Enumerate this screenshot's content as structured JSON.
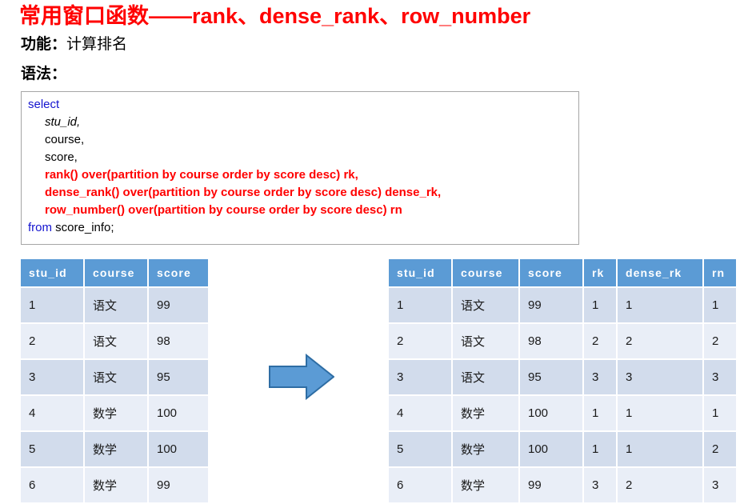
{
  "slide": {
    "title": "常用窗口函数——rank、dense_rank、row_number",
    "function_label": "功能：",
    "function_value": "计算排名",
    "syntax_label": "语法："
  },
  "colors": {
    "title_red": "#ff0000",
    "keyword_blue": "#1414cf",
    "code_red": "#ff0000",
    "header_blue": "#5b9bd5",
    "row_odd": "#d2dcec",
    "row_even": "#e9eef7",
    "arrow_fill": "#5b9bd5",
    "arrow_stroke": "#2e6da4",
    "code_border": "#a6a6a6"
  },
  "code": {
    "lines": [
      {
        "text": "select",
        "style": "keyword"
      },
      {
        "text": "stu_id,",
        "style": "italic-indent"
      },
      {
        "text": "course,",
        "style": "plain-indent"
      },
      {
        "text": "score,",
        "style": "plain-indent"
      },
      {
        "text": "rank() over(partition by course order by score desc) rk,",
        "style": "red-indent"
      },
      {
        "text": "dense_rank() over(partition by course order by score desc) dense_rk,",
        "style": "red-indent"
      },
      {
        "text": "row_number() over(partition by course order by score desc) rn",
        "style": "red-indent"
      }
    ],
    "last_line_keyword": "from",
    "last_line_rest": " score_info;"
  },
  "table_left": {
    "name": "score_info",
    "columns": [
      "stu_id",
      "course",
      "score"
    ],
    "rows": [
      [
        "1",
        "语文",
        "99"
      ],
      [
        "2",
        "语文",
        "98"
      ],
      [
        "3",
        "语文",
        "95"
      ],
      [
        "4",
        "数学",
        "100"
      ],
      [
        "5",
        "数学",
        "100"
      ],
      [
        "6",
        "数学",
        "99"
      ]
    ]
  },
  "table_right": {
    "name": "result",
    "columns": [
      "stu_id",
      "course",
      "score",
      "rk",
      "dense_rk",
      "rn"
    ],
    "rows": [
      [
        "1",
        "语文",
        "99",
        "1",
        "1",
        "1"
      ],
      [
        "2",
        "语文",
        "98",
        "2",
        "2",
        "2"
      ],
      [
        "3",
        "语文",
        "95",
        "3",
        "3",
        "3"
      ],
      [
        "4",
        "数学",
        "100",
        "1",
        "1",
        "1"
      ],
      [
        "5",
        "数学",
        "100",
        "1",
        "1",
        "2"
      ],
      [
        "6",
        "数学",
        "99",
        "3",
        "2",
        "3"
      ]
    ]
  },
  "arrow": {
    "direction": "right",
    "label": "transforms-to"
  }
}
